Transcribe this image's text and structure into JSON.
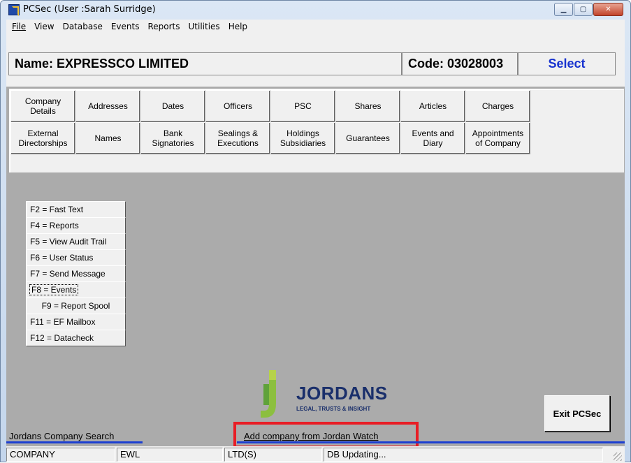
{
  "window": {
    "title": "PCSec (User :Sarah Surridge)"
  },
  "menu": [
    {
      "label": "File"
    },
    {
      "label": "View"
    },
    {
      "label": "Database"
    },
    {
      "label": "Events"
    },
    {
      "label": "Reports"
    },
    {
      "label": "Utilities"
    },
    {
      "label": "Help"
    }
  ],
  "header": {
    "name": "Name: EXPRESSCO LIMITED",
    "code": "Code: 03028003",
    "select_label": "Select"
  },
  "tabs_row1": [
    "Company\nDetails",
    "Addresses",
    "Dates",
    "Officers",
    "PSC",
    "Shares",
    "Articles",
    "Charges"
  ],
  "tabs_row2": [
    "External\nDirectorships",
    "Names",
    "Bank\nSignatories",
    "Sealings &\nExecutions",
    "Holdings\nSubsidiaries",
    "Guarantees",
    "Events and\nDiary",
    "Appointments\nof Company"
  ],
  "function_keys": [
    "F2 = Fast Text",
    "F4 = Reports",
    "F5 = View Audit Trail",
    "F6 = User Status",
    "F7 = Send Message",
    "F8 = Events",
    "F9 = Report Spool",
    "F11 = EF Mailbox",
    "F12 = Datacheck"
  ],
  "logo": {
    "name": "JORDANS",
    "tagline": "LEGAL, TRUSTS & INSIGHT"
  },
  "exit_label": "Exit PCSec",
  "jordans_search_label": "Jordans Company Search",
  "jordan_watch_link": "Add company from Jordan Watch",
  "status": {
    "panel1": "COMPANY",
    "panel2": "EWL",
    "panel3": "LTD(S)",
    "panel4": "DB Updating..."
  },
  "colors": {
    "select": "#1732cf",
    "highlight": "#e81d25",
    "blue_line": "#1c3fd1"
  }
}
